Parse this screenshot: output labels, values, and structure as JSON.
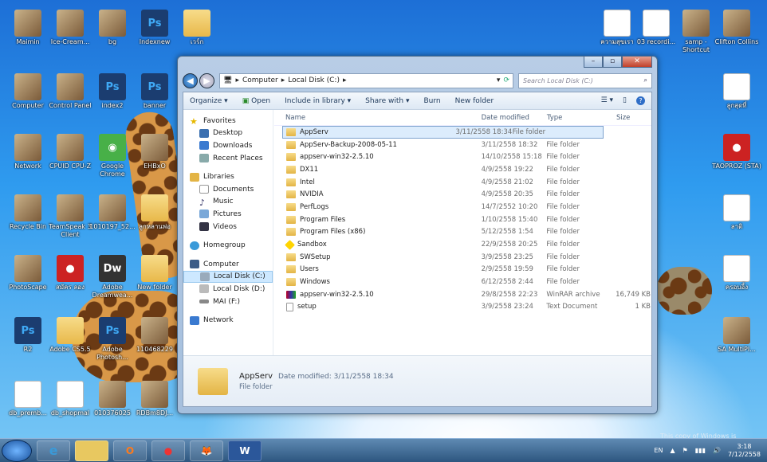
{
  "desktop": {
    "icons": [
      {
        "label": "Maimin",
        "kind": "person"
      },
      {
        "label": "Ice-Cream...",
        "kind": "photo"
      },
      {
        "label": "bg",
        "kind": "pattern"
      },
      {
        "label": "Indexnew",
        "kind": "psd"
      },
      {
        "label": "เวร์ก",
        "kind": "folder"
      },
      {
        "label": "Computer",
        "kind": "computer"
      },
      {
        "label": "Control Panel",
        "kind": "control"
      },
      {
        "label": "index2",
        "kind": "psd"
      },
      {
        "label": "banner",
        "kind": "psd"
      },
      {
        "label": "Network",
        "kind": "network"
      },
      {
        "label": "CPUID CPU-Z",
        "kind": "app"
      },
      {
        "label": "Google Chrome",
        "kind": "chrome"
      },
      {
        "label": "EHBxO",
        "kind": "photo"
      },
      {
        "label": "Recycle Bin",
        "kind": "bin"
      },
      {
        "label": "TeamSpeak 3 Client",
        "kind": "app"
      },
      {
        "label": "1010197_52...",
        "kind": "photo"
      },
      {
        "label": "ลูกหลานพ่อ",
        "kind": "folder"
      },
      {
        "label": "PhotoScape",
        "kind": "app"
      },
      {
        "label": "สมัคร ลอง",
        "kind": "red"
      },
      {
        "label": "Adobe Dreamwea...",
        "kind": "dw"
      },
      {
        "label": "New folder",
        "kind": "folder"
      },
      {
        "label": "R2",
        "kind": "psd"
      },
      {
        "label": "Adobe CS5.5",
        "kind": "folder"
      },
      {
        "label": "Adobe Photosh...",
        "kind": "ps"
      },
      {
        "label": "110468229",
        "kind": "photo"
      },
      {
        "label": "db_premb...",
        "kind": "doc"
      },
      {
        "label": "db_shopmal",
        "kind": "doc"
      },
      {
        "label": "010376025",
        "kind": "photo"
      },
      {
        "label": "RDBm8DJ...",
        "kind": "photo"
      },
      {
        "label": "ความสุขเรา",
        "kind": "doc"
      },
      {
        "label": "03 recordi...",
        "kind": "wav"
      },
      {
        "label": "samp - Shortcut",
        "kind": "photo"
      },
      {
        "label": "Clifton Collins",
        "kind": "person"
      },
      {
        "label": "ลูกสุดที่",
        "kind": "doc"
      },
      {
        "label": "TAOPROZ (STA)",
        "kind": "red"
      },
      {
        "label": "ลาติ",
        "kind": "doc"
      },
      {
        "label": "ครอบอิ้ง",
        "kind": "doc"
      },
      {
        "label": "SA MultiPl...",
        "kind": "app"
      }
    ],
    "watermark": "This copy of Windows is"
  },
  "window": {
    "title_buttons": [
      "–",
      "▫",
      "✕"
    ],
    "breadcrumb": [
      "Computer",
      "Local Disk (C:)"
    ],
    "search_placeholder": "Search Local Disk (C:)",
    "toolbar": [
      "Organize ▾",
      "Open",
      "Include in library ▾",
      "Share with ▾",
      "Burn",
      "New folder"
    ],
    "nav": {
      "favorites_label": "Favorites",
      "favorites": [
        "Desktop",
        "Downloads",
        "Recent Places"
      ],
      "libraries_label": "Libraries",
      "libraries": [
        "Documents",
        "Music",
        "Pictures",
        "Videos"
      ],
      "homegroup": "Homegroup",
      "computer_label": "Computer",
      "drives": [
        "Local Disk (C:)",
        "Local Disk (D:)",
        "MAI (F:)"
      ],
      "network": "Network"
    },
    "columns": [
      "Name",
      "Date modified",
      "Type",
      "Size"
    ],
    "files": [
      {
        "name": "AppServ",
        "date": "3/11/2558 18:34",
        "type": "File folder",
        "size": "",
        "icon": "folder"
      },
      {
        "name": "AppServ-Backup-2008-05-11",
        "date": "3/11/2558 18:32",
        "type": "File folder",
        "size": "",
        "icon": "folder"
      },
      {
        "name": "appserv-win32-2.5.10",
        "date": "14/10/2558 15:18",
        "type": "File folder",
        "size": "",
        "icon": "folder"
      },
      {
        "name": "DX11",
        "date": "4/9/2558 19:22",
        "type": "File folder",
        "size": "",
        "icon": "folder"
      },
      {
        "name": "Intel",
        "date": "4/9/2558 21:02",
        "type": "File folder",
        "size": "",
        "icon": "folder"
      },
      {
        "name": "NVIDIA",
        "date": "4/9/2558 20:35",
        "type": "File folder",
        "size": "",
        "icon": "folder"
      },
      {
        "name": "PerfLogs",
        "date": "14/7/2552 10:20",
        "type": "File folder",
        "size": "",
        "icon": "folder"
      },
      {
        "name": "Program Files",
        "date": "1/10/2558 15:40",
        "type": "File folder",
        "size": "",
        "icon": "folder"
      },
      {
        "name": "Program Files (x86)",
        "date": "5/12/2558 1:54",
        "type": "File folder",
        "size": "",
        "icon": "folder"
      },
      {
        "name": "Sandbox",
        "date": "22/9/2558 20:25",
        "type": "File folder",
        "size": "",
        "icon": "sand"
      },
      {
        "name": "SWSetup",
        "date": "3/9/2558 23:25",
        "type": "File folder",
        "size": "",
        "icon": "folder"
      },
      {
        "name": "Users",
        "date": "2/9/2558 19:59",
        "type": "File folder",
        "size": "",
        "icon": "folder"
      },
      {
        "name": "Windows",
        "date": "6/12/2558 2:44",
        "type": "File folder",
        "size": "",
        "icon": "folder"
      },
      {
        "name": "appserv-win32-2.5.10",
        "date": "29/8/2558 22:23",
        "type": "WinRAR archive",
        "size": "16,749 KB",
        "icon": "rar"
      },
      {
        "name": "setup",
        "date": "3/9/2558 23:24",
        "type": "Text Document",
        "size": "1 KB",
        "icon": "txt"
      }
    ],
    "details": {
      "name": "AppServ",
      "meta": "Date modified: 3/11/2558 18:34",
      "type": "File folder"
    }
  },
  "taskbar": {
    "apps": [
      "e",
      "",
      "O",
      "●",
      "🦊",
      "W"
    ],
    "lang": "EN",
    "time": "3:18",
    "date": "7/12/2558"
  }
}
